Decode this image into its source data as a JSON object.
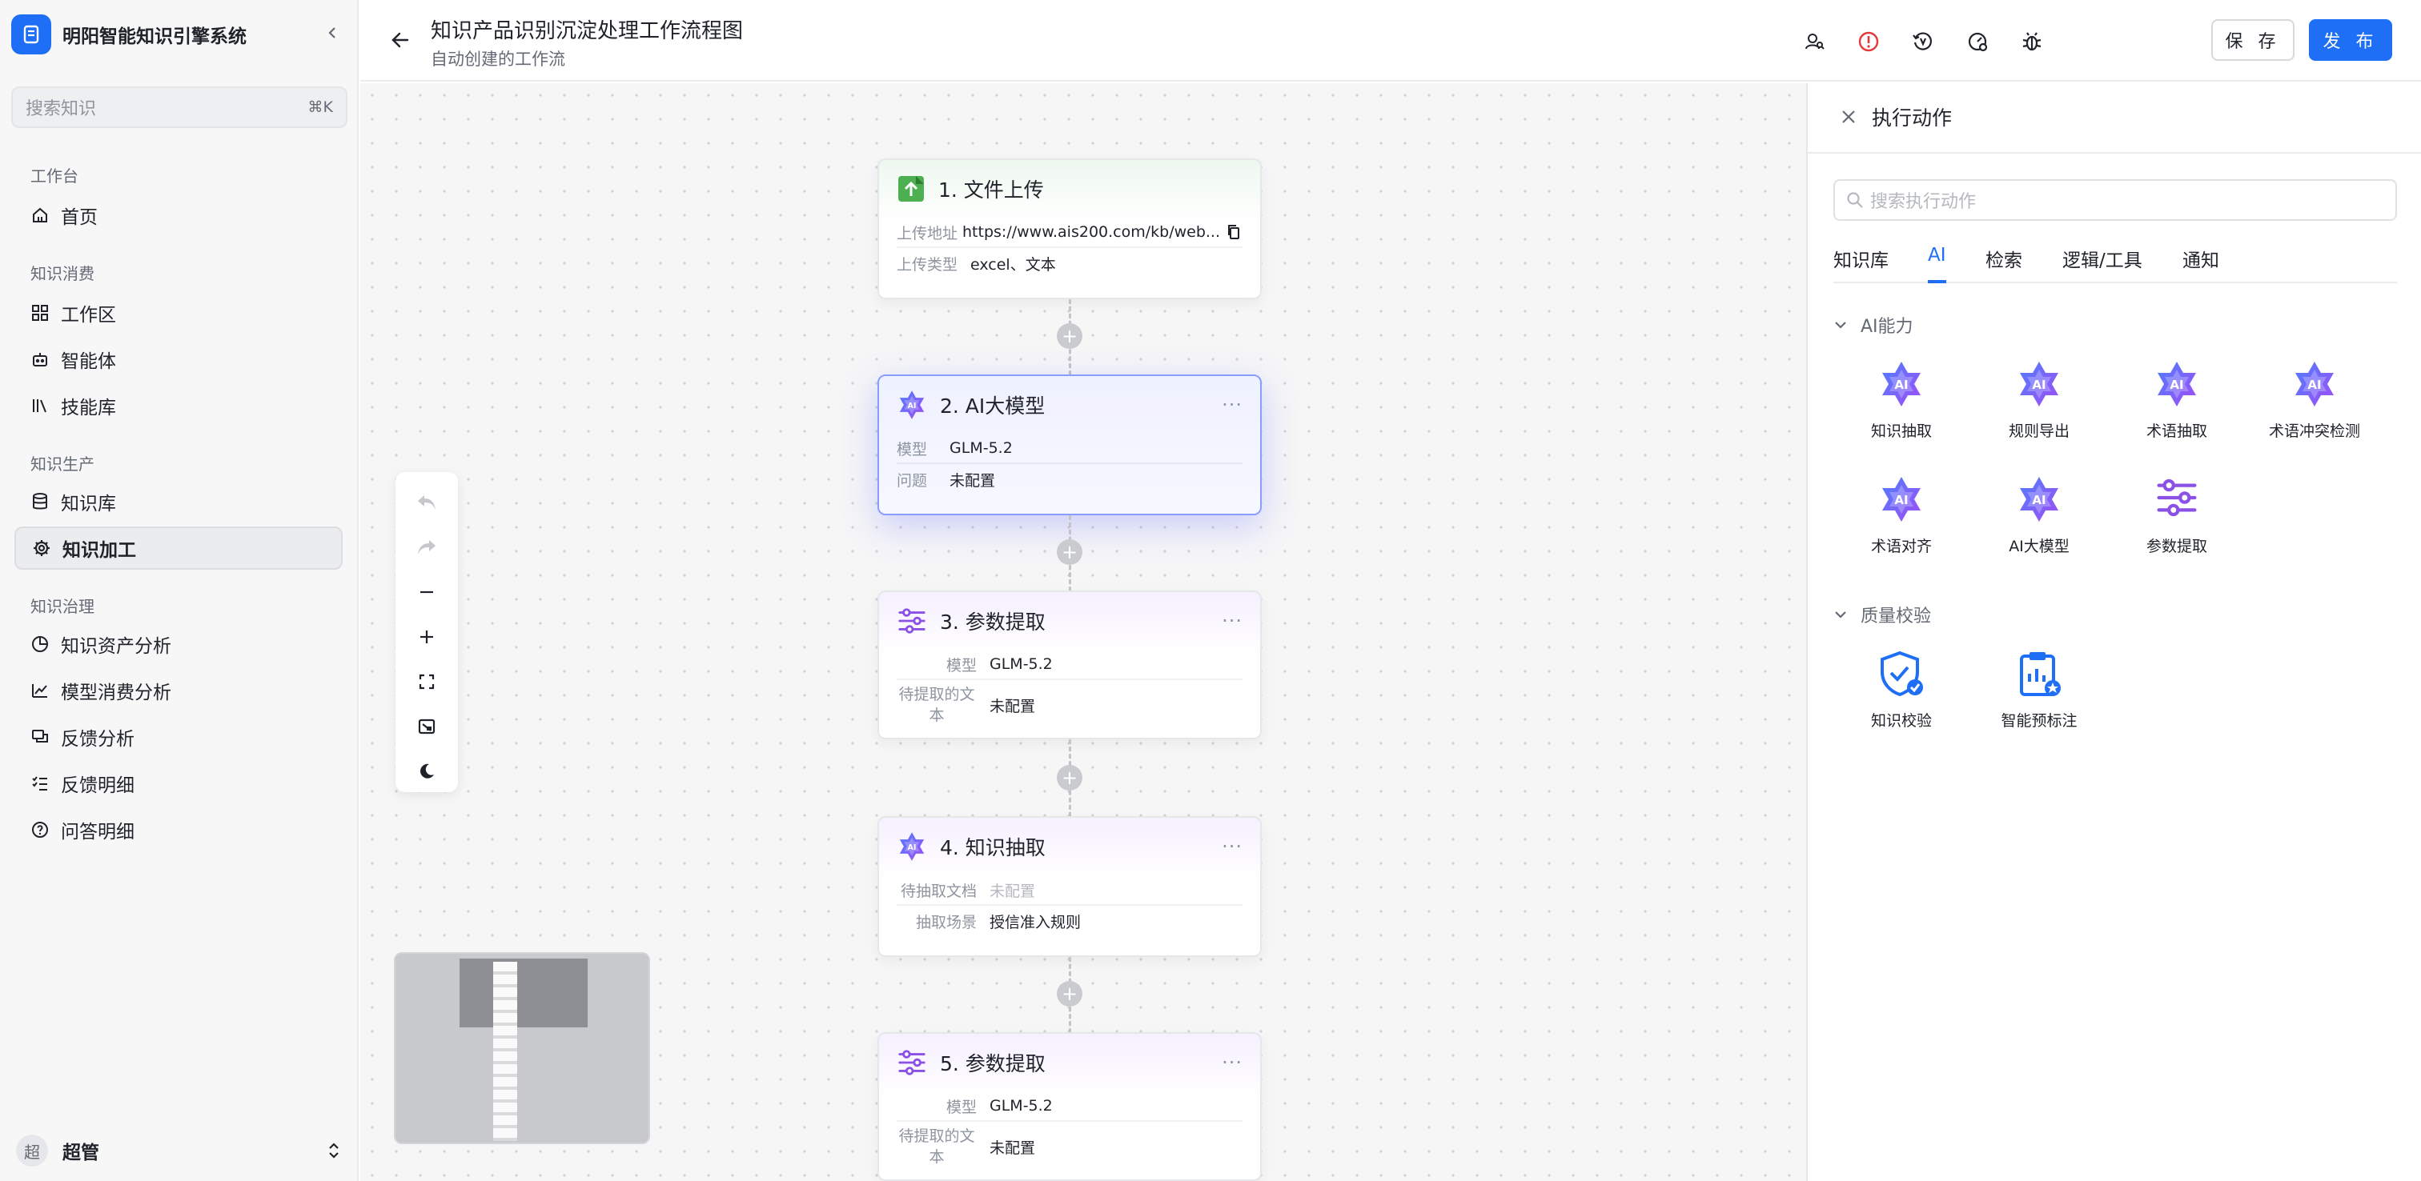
{
  "app": {
    "name": "明阳智能知识引擎系统"
  },
  "search": {
    "placeholder": "搜索知识",
    "shortcut": "⌘K"
  },
  "sidebar": {
    "sections": [
      {
        "title": "工作台",
        "items": [
          {
            "label": "首页",
            "icon": "home-icon"
          }
        ]
      },
      {
        "title": "知识消费",
        "items": [
          {
            "label": "工作区",
            "icon": "grid-icon"
          },
          {
            "label": "智能体",
            "icon": "robot-icon"
          },
          {
            "label": "技能库",
            "icon": "library-icon"
          }
        ]
      },
      {
        "title": "知识生产",
        "items": [
          {
            "label": "知识库",
            "icon": "database-icon"
          },
          {
            "label": "知识加工",
            "icon": "gear-icon",
            "active": true
          }
        ]
      },
      {
        "title": "知识治理",
        "items": [
          {
            "label": "知识资产分析",
            "icon": "pie-chart-icon"
          },
          {
            "label": "模型消费分析",
            "icon": "line-chart-icon"
          },
          {
            "label": "反馈分析",
            "icon": "feedback-icon"
          },
          {
            "label": "反馈明细",
            "icon": "checklist-icon"
          },
          {
            "label": "问答明细",
            "icon": "question-icon"
          }
        ]
      }
    ]
  },
  "user": {
    "avatar_text": "超",
    "name": "超管"
  },
  "header": {
    "title": "知识产品识别沉淀处理工作流程图",
    "subtitle": "自动创建的工作流",
    "save": "保 存",
    "publish": "发 布"
  },
  "nodes": [
    {
      "title": "1. 文件上传",
      "icon": "upload-icon",
      "rows": [
        {
          "k": "上传地址",
          "v": "https://www.ais200.com/kb/web..."
        },
        {
          "k": "上传类型",
          "v": "excel、文本"
        }
      ]
    },
    {
      "title": "2. AI大模型",
      "icon": "ai-star-icon",
      "rows": [
        {
          "k": "模型",
          "v": "GLM-5.2"
        },
        {
          "k": "问题",
          "v": "未配置"
        }
      ]
    },
    {
      "title": "3. 参数提取",
      "icon": "sliders-icon",
      "rows": [
        {
          "k": "模型",
          "v": "GLM-5.2"
        },
        {
          "k": "待提取的文本",
          "v": "未配置"
        }
      ]
    },
    {
      "title": "4. 知识抽取",
      "icon": "ai-star-icon",
      "rows": [
        {
          "k": "待抽取文档",
          "v": "未配置"
        },
        {
          "k": "抽取场景",
          "v": "授信准入规则"
        }
      ]
    },
    {
      "title": "5. 参数提取",
      "icon": "sliders-icon",
      "rows": [
        {
          "k": "模型",
          "v": "GLM-5.2"
        },
        {
          "k": "待提取的文本",
          "v": "未配置"
        }
      ]
    }
  ],
  "panel": {
    "title": "执行动作",
    "search_placeholder": "搜索执行动作",
    "tabs": [
      "知识库",
      "AI",
      "检索",
      "逻辑/工具",
      "通知"
    ],
    "active_tab": "AI",
    "groups": [
      {
        "title": "AI能力",
        "items": [
          "知识抽取",
          "规则导出",
          "术语抽取",
          "术语冲突检测",
          "术语对齐",
          "AI大模型",
          "参数提取"
        ]
      },
      {
        "title": "质量校验",
        "items": [
          "知识校验",
          "智能预标注"
        ]
      }
    ]
  },
  "colors": {
    "accent": "#1e6ff5",
    "danger": "#e5383b",
    "ai_purple": "#7b5cf5",
    "upload_green": "#4caf50"
  }
}
